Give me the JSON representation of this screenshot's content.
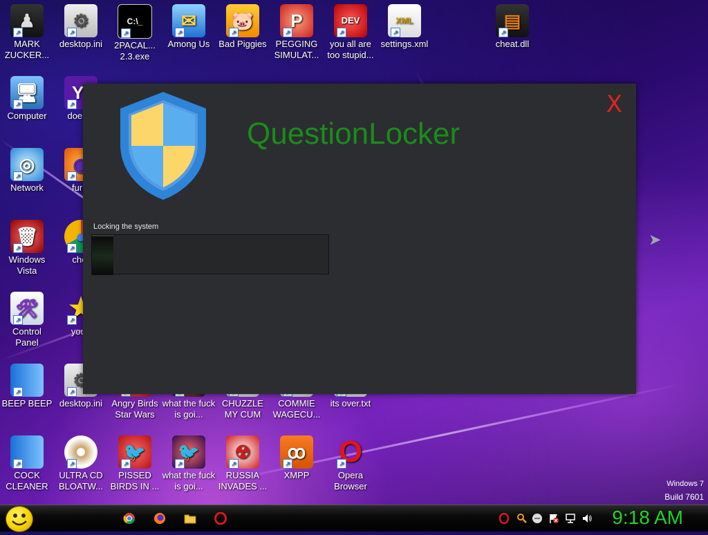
{
  "desktop": {
    "icons": [
      {
        "label": "MARK ZUCKER...",
        "icon": "mark-zuckerberg-icon"
      },
      {
        "label": "desktop.ini",
        "icon": "ini-file-icon"
      },
      {
        "label": "2PACAL... 2.3.exe",
        "icon": "cmd-exe-icon"
      },
      {
        "label": "Among Us",
        "icon": "among-us-icon"
      },
      {
        "label": "Bad Piggies",
        "icon": "bad-piggies-icon"
      },
      {
        "label": "PEGGING SIMULAT...",
        "icon": "pegging-icon"
      },
      {
        "label": "you all are too stupid...",
        "icon": "dev-cpp-icon"
      },
      {
        "label": "settings.xml",
        "icon": "xml-file-icon"
      },
      {
        "label": "cheat.dll",
        "icon": "dll-file-icon"
      },
      {
        "label": "Computer",
        "icon": "computer-icon"
      },
      {
        "label": "doesnt",
        "icon": "yahoo-icon"
      },
      {
        "label": "Network",
        "icon": "network-icon"
      },
      {
        "label": "furry",
        "icon": "firefox-icon"
      },
      {
        "label": "Windows Vista",
        "icon": "recycle-bin-icon"
      },
      {
        "label": "chor",
        "icon": "chrome-icon"
      },
      {
        "label": "Control Panel",
        "icon": "control-panel-icon"
      },
      {
        "label": "you t",
        "icon": "star-icon"
      },
      {
        "label": "BEEP BEEP",
        "icon": "blue-bar-icon"
      },
      {
        "label": "desktop.ini",
        "icon": "ini-file-icon"
      },
      {
        "label": "Angry Birds Star Wars",
        "icon": "angry-birds-icon"
      },
      {
        "label": "what the fuck is goi...",
        "icon": "shortcut-icon"
      },
      {
        "label": "CHUZZLE MY CUM",
        "icon": "chuzzle-icon"
      },
      {
        "label": "COMMIE WAGECU...",
        "icon": "commie-icon"
      },
      {
        "label": "its over.txt",
        "icon": "txt-file-icon"
      },
      {
        "label": "COCK CLEANER",
        "icon": "blue-bar-icon"
      },
      {
        "label": "ULTRA CD BLOATW...",
        "icon": "cd-icon"
      },
      {
        "label": "PISSED BIRDS IN ...",
        "icon": "angry-birds-icon"
      },
      {
        "label": "what the fuck is goi...",
        "icon": "angry-birds-space-icon"
      },
      {
        "label": "RUSSIA INVADES ...",
        "icon": "radiation-icon"
      },
      {
        "label": "XMPP",
        "icon": "xampp-icon"
      },
      {
        "label": "Opera Browser",
        "icon": "opera-icon"
      }
    ],
    "watermark_line1": "Windows 7",
    "watermark_line2": "Build 7601"
  },
  "locker": {
    "title": "QuestionLocker",
    "close_label": "X",
    "status_text": "Locking the system",
    "progress": 0.09,
    "title_color": "#1a8c1a",
    "close_color": "#e0241b"
  },
  "taskbar": {
    "pinned": [
      "chrome-icon",
      "firefox-icon",
      "folder-icon",
      "opera-icon"
    ],
    "tray": [
      "opera-tray-icon",
      "search-tray-icon",
      "messenger-tray-icon",
      "action-center-flag-icon",
      "network-tray-icon",
      "volume-icon"
    ],
    "clock": "9:18 AM",
    "clock_color": "#1fd61f"
  }
}
